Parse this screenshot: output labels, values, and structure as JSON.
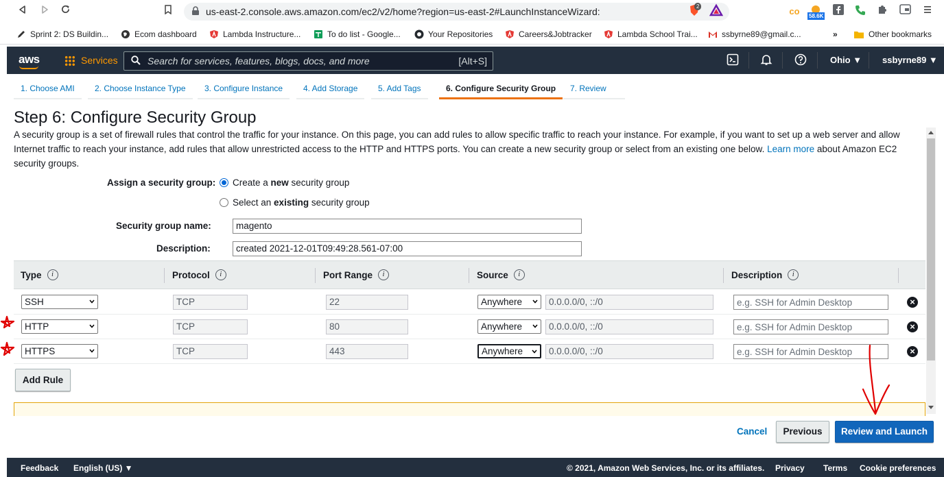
{
  "browser": {
    "url": "us-east-2.console.aws.amazon.com/ec2/v2/home?region=us-east-2#LaunchInstanceWizard:",
    "brave_badge": "2",
    "ext_badge": "58.6K",
    "bookmarks": [
      {
        "label": "Sprint 2: DS Buildin...",
        "icon": "pen-icon",
        "color": "#333333"
      },
      {
        "label": "Ecom dashboard",
        "icon": "globe-icon",
        "color": "#333333"
      },
      {
        "label": "Lambda Instructure...",
        "icon": "lambda-shield-icon",
        "color": "#e53935"
      },
      {
        "label": "To do list - Google...",
        "icon": "sheets-icon",
        "color": "#0f9d58"
      },
      {
        "label": "Your Repositories",
        "icon": "github-icon",
        "color": "#24292e"
      },
      {
        "label": "Careers&Jobtracker",
        "icon": "lambda-shield-icon",
        "color": "#e53935"
      },
      {
        "label": "Lambda School Trai...",
        "icon": "lambda-shield-icon",
        "color": "#e53935"
      },
      {
        "label": "ssbyrne89@gmail.c...",
        "icon": "gmail-icon",
        "color": "#d93025"
      }
    ],
    "more_bookmarks": "»",
    "other_bookmarks": "Other bookmarks"
  },
  "aws_header": {
    "logo": "aws",
    "services": "Services",
    "search_placeholder": "Search for services, features, blogs, docs, and more",
    "search_shortcut": "[Alt+S]",
    "region": "Ohio ▼",
    "user": "ssbyrne89 ▼"
  },
  "wizard": {
    "tabs": [
      "1. Choose AMI",
      "2. Choose Instance Type",
      "3. Configure Instance",
      "4. Add Storage",
      "5. Add Tags",
      "6. Configure Security Group",
      "7. Review"
    ],
    "active_tab": 5
  },
  "page": {
    "title": "Step 6: Configure Security Group",
    "intro_text": "A security group is a set of firewall rules that control the traffic for your instance. On this page, you can add rules to allow specific traffic to reach your instance. For example, if you want to set up a web server and allow Internet traffic to reach your instance, add rules that allow unrestricted access to the HTTP and HTTPS ports. You can create a new security group or select from an existing one below.",
    "learn_more": "Learn more",
    "intro_tail": "about Amazon EC2 security groups.",
    "assign_label": "Assign a security group:",
    "option_new_pre": "Create a ",
    "option_new_bold": "new",
    "option_new_post": " security group",
    "option_existing_pre": "Select an ",
    "option_existing_bold": "existing",
    "option_existing_post": " security group",
    "sg_name_label": "Security group name:",
    "sg_name_value": "magento",
    "description_label": "Description:",
    "description_value": "created 2021-12-01T09:49:28.561-07:00"
  },
  "rules": {
    "headers": [
      "Type",
      "Protocol",
      "Port Range",
      "Source",
      "Description"
    ],
    "info_glyph": "i",
    "rows": [
      {
        "type": "SSH",
        "protocol": "TCP",
        "port": "22",
        "source": "Anywhere",
        "cidr": "0.0.0.0/0, ::/0",
        "desc_placeholder": "e.g. SSH for Admin Desktop"
      },
      {
        "type": "HTTP",
        "protocol": "TCP",
        "port": "80",
        "source": "Anywhere",
        "cidr": "0.0.0.0/0, ::/0",
        "desc_placeholder": "e.g. SSH for Admin Desktop"
      },
      {
        "type": "HTTPS",
        "protocol": "TCP",
        "port": "443",
        "source": "Anywhere",
        "cidr": "0.0.0.0/0, ::/0",
        "desc_placeholder": "e.g. SSH for Admin Desktop"
      }
    ],
    "add_rule": "Add Rule"
  },
  "actions": {
    "cancel": "Cancel",
    "previous": "Previous",
    "review_launch": "Review and Launch"
  },
  "footer": {
    "feedback": "Feedback",
    "language": "English (US) ▼",
    "copyright": "© 2021, Amazon Web Services, Inc. or its affiliates.",
    "privacy": "Privacy",
    "terms": "Terms",
    "cookies": "Cookie preferences"
  },
  "colors": {
    "aws_dark": "#232f3e",
    "aws_orange": "#ff9900",
    "link_blue": "#0073bb",
    "primary_button": "#1166bb",
    "tab_active": "#ec7211",
    "annotation_red": "#e00000"
  }
}
